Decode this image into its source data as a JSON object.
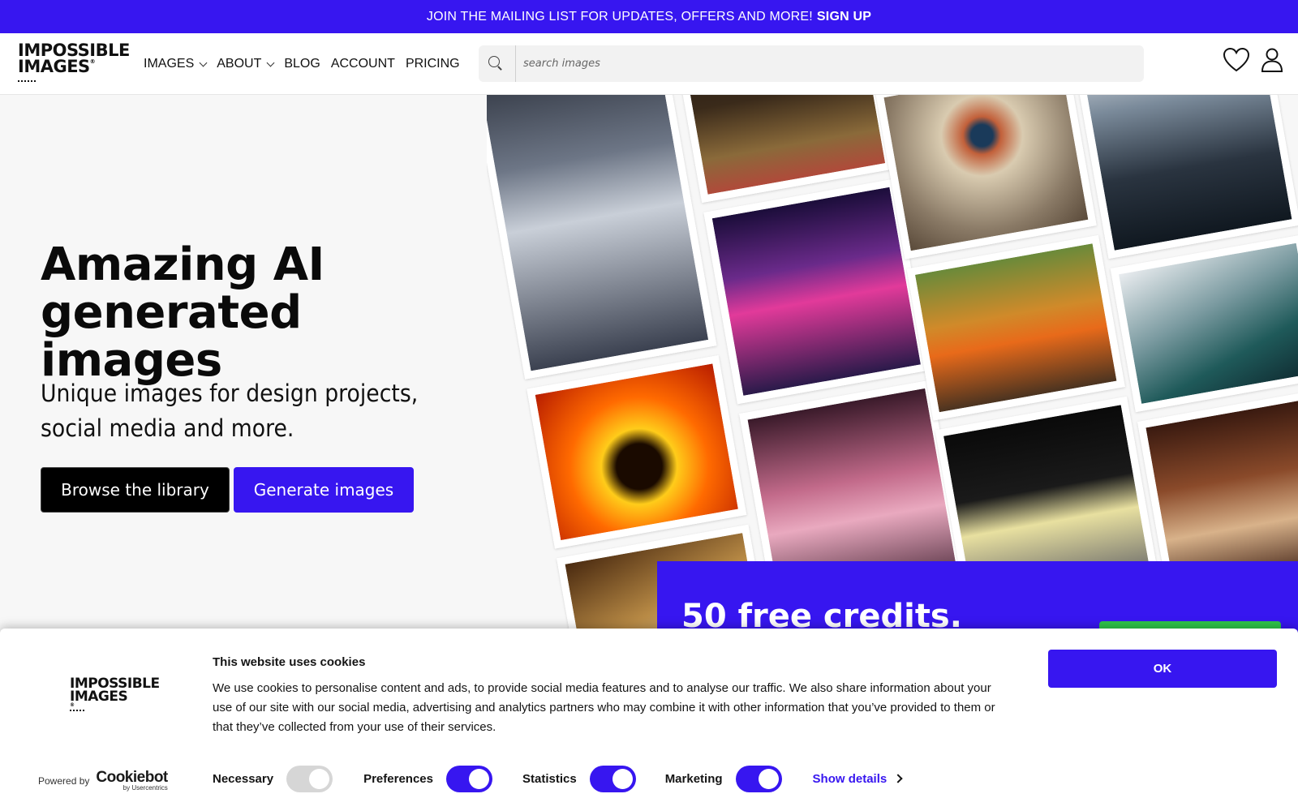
{
  "promo_bar": {
    "message": "JOIN THE MAILING LIST FOR UPDATES, OFFERS AND MORE!",
    "signup_label": "SIGN UP",
    "bg_color": "#3716f0"
  },
  "header": {
    "logo": {
      "line1": "IMPOSSIBLE",
      "line2": "IMAGES",
      "registered": "®"
    },
    "nav": [
      {
        "label": "IMAGES",
        "has_dropdown": true
      },
      {
        "label": "ABOUT",
        "has_dropdown": true
      },
      {
        "label": "BLOG"
      },
      {
        "label": "ACCOUNT"
      },
      {
        "label": "PRICING"
      }
    ],
    "search": {
      "placeholder": "search images",
      "icon": "search-icon"
    },
    "icons": [
      "heart-icon",
      "user-icon"
    ]
  },
  "hero": {
    "title_line1": "Amazing AI",
    "title_line2": "generated images",
    "subtitle": "Unique images for design projects, social media and more.",
    "browse_label": "Browse the library",
    "generate_label": "Generate images"
  },
  "promo_card": {
    "credits": "50 free credits."
  },
  "cookie_banner": {
    "logo": {
      "line1": "IMPOSSIBLE",
      "line2": "IMAGES",
      "registered": "®"
    },
    "powered_by": "Powered by",
    "cookiebot_brand": "Cookiebot",
    "cookiebot_sub": "by Usercentrics",
    "title": "This website uses cookies",
    "text": "We use cookies to personalise content and ads, to provide social media features and to analyse our traffic. We also share information about your use of our site with our social media, advertising and analytics partners who may combine it with other information that you’ve provided to them or that they’ve collected from your use of their services.",
    "ok_label": "OK",
    "toggles": [
      {
        "label": "Necessary",
        "checked": true,
        "disabled": true
      },
      {
        "label": "Preferences",
        "checked": true
      },
      {
        "label": "Statistics",
        "checked": true
      },
      {
        "label": "Marketing",
        "checked": true
      }
    ],
    "show_details_label": "Show details"
  },
  "colors": {
    "accent": "#3716f0",
    "button_dark": "#000000",
    "green": "#2ec44a"
  }
}
